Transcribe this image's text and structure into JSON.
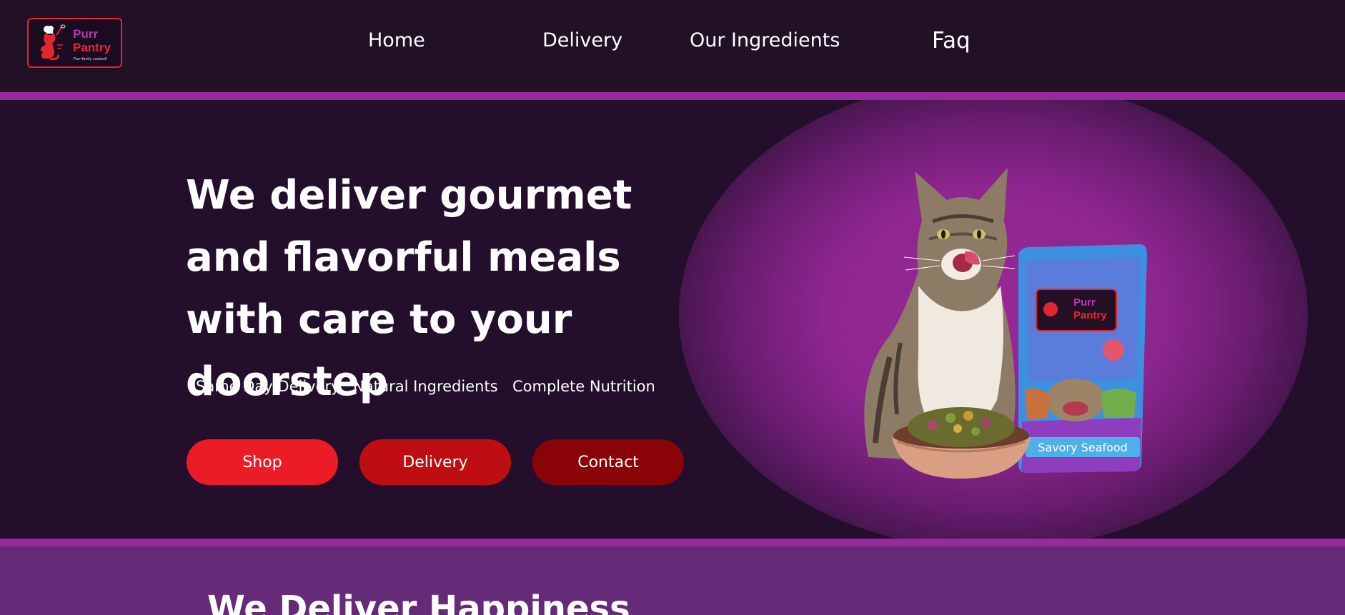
{
  "brand": {
    "name_line1": "Purr",
    "name_line2": "Pantry",
    "tagline": "Purr-fectly cooked!",
    "colors": {
      "accent_purple": "#962b9b",
      "brand_red": "#ea2431",
      "background": "#221027"
    }
  },
  "nav": {
    "items": [
      {
        "label": "Home"
      },
      {
        "label": "Delivery"
      },
      {
        "label": "Our Ingredients"
      },
      {
        "label": "Faq"
      }
    ]
  },
  "hero": {
    "title": "We deliver gourmet and flavorful meals with care to your doorstep",
    "features": [
      "Same Day Delivery",
      "Natural Ingredients",
      "Complete Nutrition"
    ],
    "buttons": [
      {
        "label": "Shop",
        "color": "#ec1c27"
      },
      {
        "label": "Delivery",
        "color": "#bf0e12"
      },
      {
        "label": "Contact",
        "color": "#8a0407"
      }
    ],
    "product": {
      "pouch_brand_line1": "Purr",
      "pouch_brand_line2": "Pantry",
      "pouch_flavor": "Savory Seafood"
    }
  },
  "section_two": {
    "title": "We Deliver Happiness"
  }
}
